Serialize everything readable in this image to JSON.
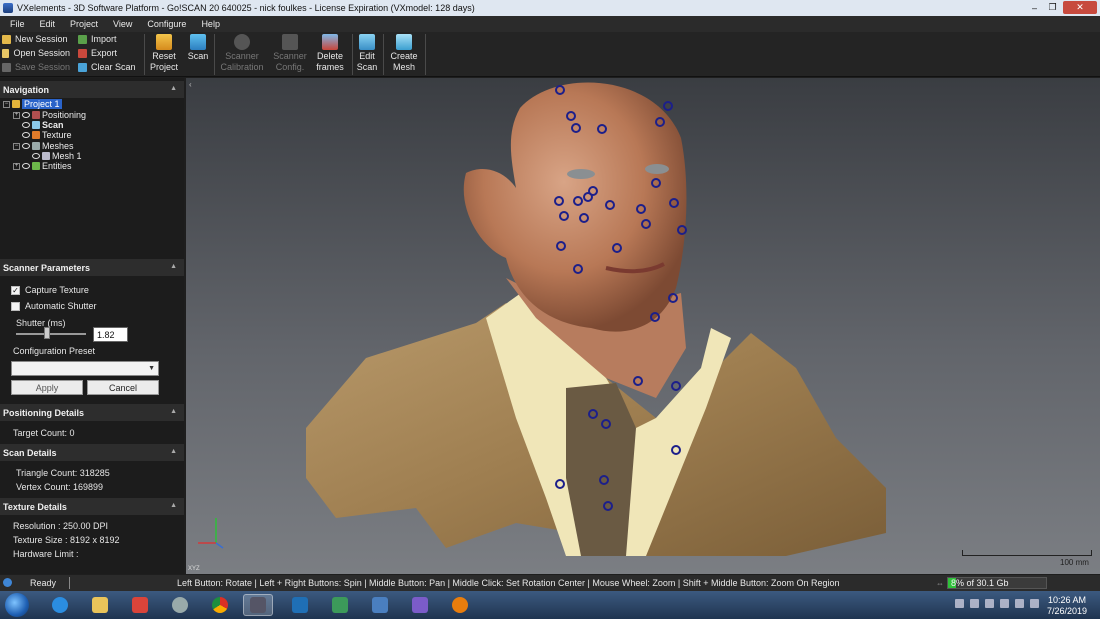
{
  "window": {
    "title": "VXelements - 3D Software Platform - Go!SCAN 20 640025 - nick foulkes - License Expiration (VXmodel: 128 days)",
    "min": "–",
    "max": "❐",
    "close": "✕"
  },
  "menu": [
    "File",
    "Edit",
    "Project",
    "View",
    "Configure",
    "Help"
  ],
  "ribbon": {
    "session": [
      "New Session",
      "Open Session",
      "Save Session"
    ],
    "io": [
      "Import",
      "Export",
      "Clear Scan"
    ],
    "buttons": [
      {
        "line1": "Reset",
        "line2": "Project"
      },
      {
        "line1": "Scan",
        "line2": ""
      },
      {
        "line1": "Scanner",
        "line2": "Calibration"
      },
      {
        "line1": "Scanner",
        "line2": "Config."
      },
      {
        "line1": "Delete",
        "line2": "frames"
      },
      {
        "line1": "Edit",
        "line2": "Scan"
      },
      {
        "line1": "Create",
        "line2": "Mesh"
      }
    ]
  },
  "navigation": {
    "title": "Navigation",
    "items": [
      "Project 1",
      "Positioning",
      "Scan",
      "Texture",
      "Meshes",
      "Mesh 1",
      "Entities"
    ]
  },
  "scanner_params": {
    "title": "Scanner Parameters",
    "capture_texture": "Capture Texture",
    "automatic_shutter": "Automatic Shutter",
    "shutter_label": "Shutter (ms)",
    "shutter_value": "1.82",
    "shutter_fraction": 0.45,
    "config_preset": "Configuration Preset",
    "apply": "Apply",
    "cancel": "Cancel"
  },
  "positioning_details": {
    "title": "Positioning Details",
    "target_count": "Target Count: 0"
  },
  "scan_details": {
    "title": "Scan Details",
    "triangle_count": "Triangle Count: 318285",
    "vertex_count": "Vertex Count: 169899"
  },
  "texture_details": {
    "title": "Texture Details",
    "resolution": "Resolution : 250.00 DPI",
    "texture_size": "Texture Size : 8192 x 8192",
    "hardware_limit": "Hardware Limit :"
  },
  "viewport": {
    "axis_label": "XYZ",
    "scale_label": "100 mm"
  },
  "status": {
    "ready": "Ready",
    "hint": "Left Button: Rotate  |  Left + Right Buttons: Spin  |  Middle Button: Pan  |  Middle Click: Set Rotation Center  |  Mouse Wheel: Zoom  |  Shift + Middle Button: Zoom On Region",
    "memory": "8% of 30.1 Gb",
    "memory_fraction": 0.08
  },
  "clock": {
    "time": "10:26 AM",
    "date": "7/26/2019"
  },
  "colors": {
    "accent": "#2a63c9",
    "memory_green": "#2fc23a"
  }
}
